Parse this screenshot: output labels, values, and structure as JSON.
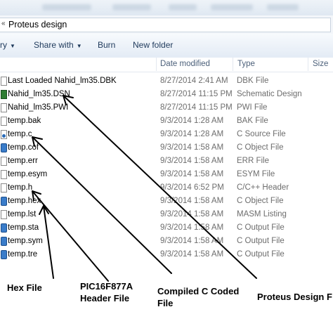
{
  "window": {
    "path_separator": "«",
    "folder": "Proteus  design"
  },
  "toolbar": {
    "organize_label": "ry",
    "share_label": "Share with",
    "burn_label": "Burn",
    "new_folder_label": "New folder"
  },
  "columns": {
    "name": "",
    "date": "Date modified",
    "type": "Type",
    "size": "Size"
  },
  "files": [
    {
      "name": "Last Loaded Nahid_lm35.DBK",
      "date": "8/27/2014 2:41 AM",
      "type": "DBK File",
      "icon": "document-icon"
    },
    {
      "name": "Nahid_lm35.DSN",
      "date": "8/27/2014 11:15 PM",
      "type": "Schematic Design",
      "icon": "proteus-dsn-icon"
    },
    {
      "name": "Nahid_lm35.PWI",
      "date": "8/27/2014 11:15 PM",
      "type": "PWI File",
      "icon": "document-icon"
    },
    {
      "name": "temp.bak",
      "date": "9/3/2014 1:28 AM",
      "type": "BAK File",
      "icon": "document-icon"
    },
    {
      "name": "temp.c",
      "date": "9/3/2014 1:28 AM",
      "type": "C Source File",
      "icon": "c-source-icon"
    },
    {
      "name": "temp.cof",
      "date": "9/3/2014 1:58 AM",
      "type": "C Object File",
      "icon": "object-file-icon"
    },
    {
      "name": "temp.err",
      "date": "9/3/2014 1:58 AM",
      "type": "ERR File",
      "icon": "document-icon"
    },
    {
      "name": "temp.esym",
      "date": "9/3/2014 1:58 AM",
      "type": "ESYM File",
      "icon": "document-icon"
    },
    {
      "name": "temp.h",
      "date": "9/3/2014 6:52 PM",
      "type": "C/C++ Header",
      "icon": "header-file-icon"
    },
    {
      "name": "temp.hex",
      "date": "9/3/2014 1:58 AM",
      "type": "C Object File",
      "icon": "object-file-icon"
    },
    {
      "name": "temp.lst",
      "date": "9/3/2014 1:58 AM",
      "type": "MASM Listing",
      "icon": "document-icon"
    },
    {
      "name": "temp.sta",
      "date": "9/3/2014 1:58 AM",
      "type": "C Output File",
      "icon": "object-file-icon"
    },
    {
      "name": "temp.sym",
      "date": "9/3/2014 1:58 AM",
      "type": "C Output File",
      "icon": "object-file-icon"
    },
    {
      "name": "temp.tre",
      "date": "9/3/2014 1:58 AM",
      "type": "C Output File",
      "icon": "object-file-icon"
    }
  ],
  "annotations": {
    "hex_label": "Hex File",
    "header_line1": "PIC16F877A",
    "header_line2": "Header File",
    "compiled_line1": "Compiled C Coded",
    "compiled_line2": "File",
    "proteus_label": "Proteus Design F"
  },
  "colors": {
    "toolbar_text": "#1e395b",
    "column_header_text": "#4c607a",
    "meta_text": "#6d6d6d"
  }
}
